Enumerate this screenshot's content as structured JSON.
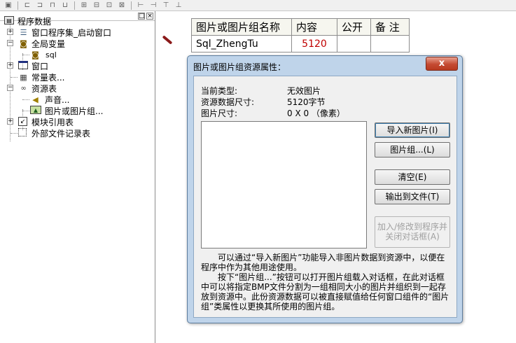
{
  "toolbar": {
    "icons": [
      "save-icon",
      "align-left-icon",
      "align-right-icon",
      "align-top-icon",
      "align-bottom-icon",
      "center-h-icon",
      "center-v-icon",
      "same-width-icon",
      "same-height-icon",
      "same-size-icon",
      "spacing-h-icon",
      "spacing-v-icon",
      "grid-icon"
    ]
  },
  "panel": {
    "pin_glyph": "□",
    "close_glyph": "×"
  },
  "tree": {
    "root": "程序数据",
    "items": [
      {
        "label": "窗口程序集_启动窗口",
        "expander": "+"
      },
      {
        "label": "全局变量",
        "expander": "−"
      },
      {
        "label": "sql",
        "expander": ""
      },
      {
        "label": "窗口",
        "expander": "+"
      },
      {
        "label": "常量表...",
        "expander": ""
      },
      {
        "label": "资源表",
        "expander": "−"
      },
      {
        "label": "声音...",
        "expander": ""
      },
      {
        "label": "图片或图片组...",
        "expander": ""
      },
      {
        "label": "模块引用表",
        "expander": "+"
      },
      {
        "label": "外部文件记录表",
        "expander": ""
      }
    ]
  },
  "resource_table": {
    "headers": [
      "图片或图片组名称",
      "内容",
      "公开",
      "备 注"
    ],
    "row": {
      "name": "Sql_ZhengTu",
      "content": "5120",
      "public": "",
      "note": ""
    }
  },
  "dialog": {
    "title": "图片或图片组资源属性：",
    "close": "x",
    "type_label": "当前类型:",
    "type_value": "无效图片",
    "size_label": "资源数据尺寸:",
    "size_value": "5120字节",
    "dim_label": "图片尺寸:",
    "dim_value": "0 X 0 （像素）",
    "buttons": {
      "import": "导入新图片(I)",
      "group": "图片组...(L)",
      "clear": "清空(E)",
      "export": "输出到文件(T)",
      "add_modify": "加入/修改到程序并关闭对话框(A)"
    },
    "help_p1": "可以通过“导入新图片”功能导入非图片数据到资源中，以便在程序中作为其他用途使用。",
    "help_p2": "按下“图片组...”按钮可以打开图片组载入对话框，在此对话框中可以将指定BMP文件分割为一组相同大小的图片并组织到一起存放到资源中。此份资源数据可以被直接赋值给任何窗口组件的“图片组”类属性以更换其所使用的图片组。"
  }
}
